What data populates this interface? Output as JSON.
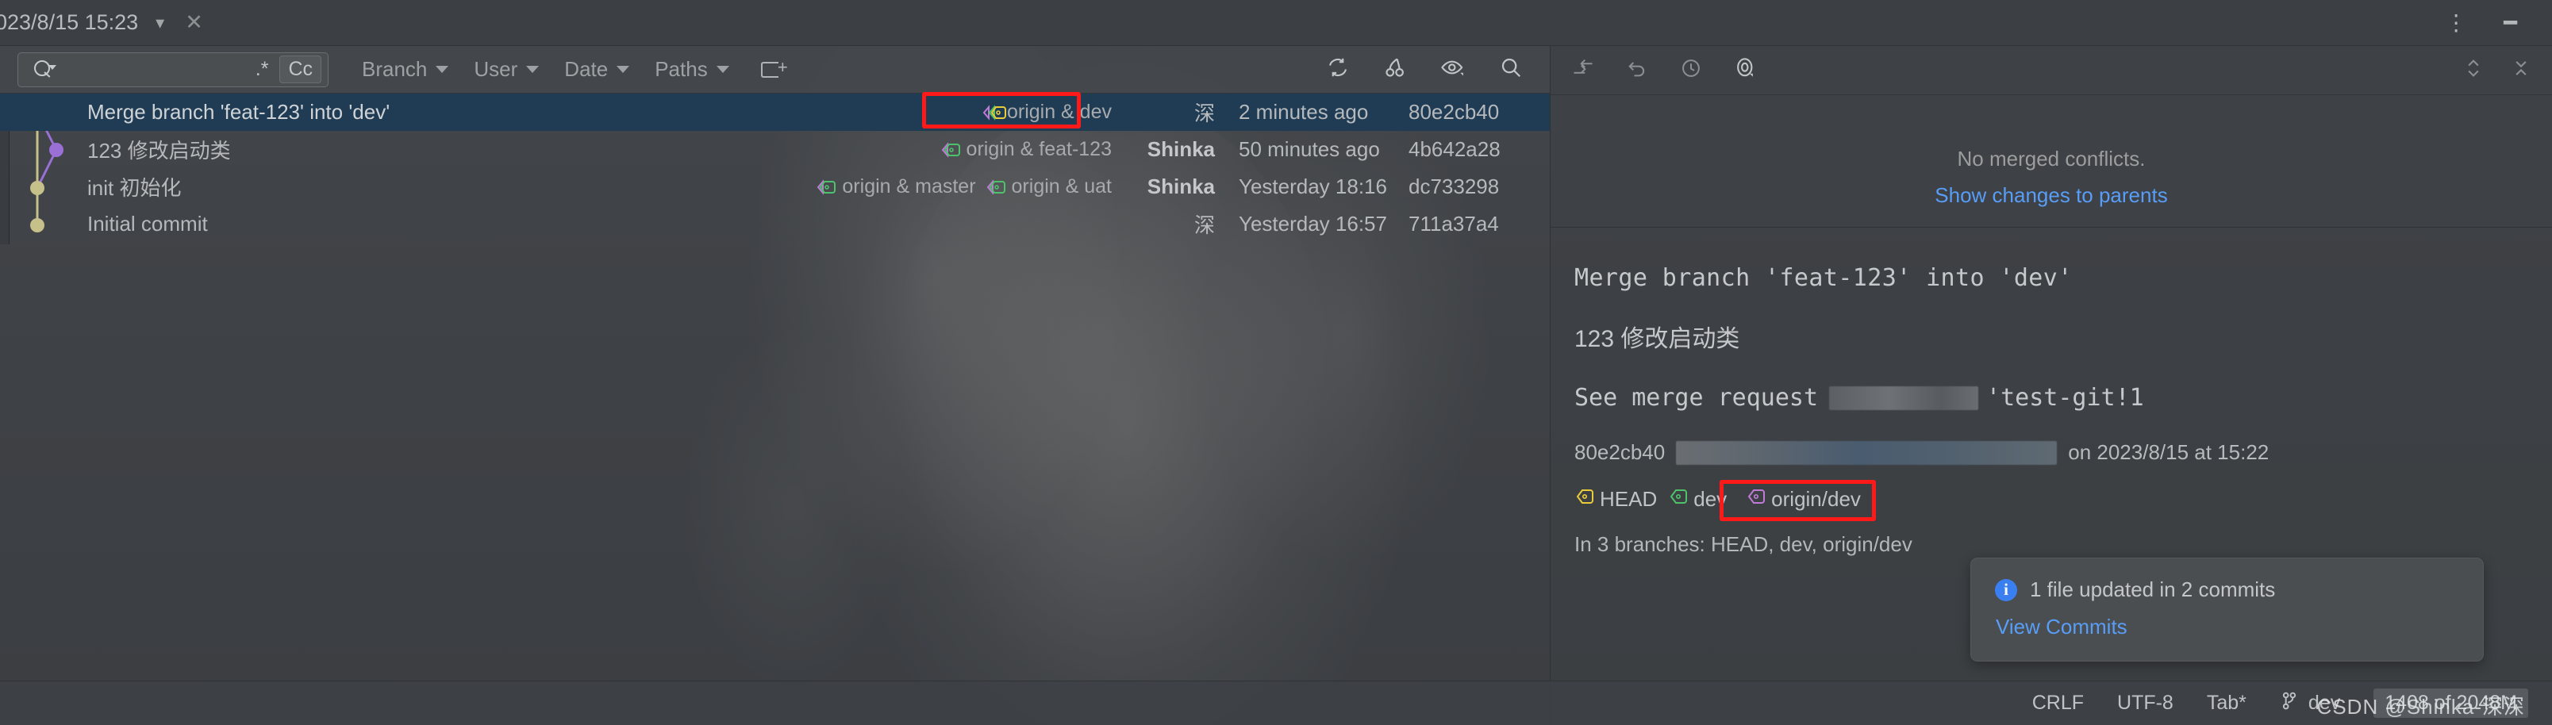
{
  "titlebar": {
    "tab_label": "023/8/15 15:23",
    "chevron_icon": "chevron-down-icon",
    "close_icon": "close-icon",
    "more_icon": "more-vertical-icon",
    "minimize_icon": "minimize-icon"
  },
  "filter_bar": {
    "search_placeholder": "",
    "search_value": "",
    "search_icon": "search-icon",
    "regex_label": ".*",
    "case_label": "Cc",
    "filters": [
      {
        "label": "Branch",
        "icon": "chevron-down-icon"
      },
      {
        "label": "User",
        "icon": "chevron-down-icon"
      },
      {
        "label": "Date",
        "icon": "chevron-down-icon"
      },
      {
        "label": "Paths",
        "icon": "chevron-down-icon"
      }
    ],
    "new_filter_icon": "new-filter-icon",
    "toolbar_icons": [
      "refresh-icon",
      "cherry-pick-icon",
      "eye-icon",
      "search-icon"
    ]
  },
  "commits": [
    {
      "subject": "Merge branch 'feat-123' into 'dev'",
      "refs": [
        {
          "label": "origin & dev",
          "type": "remote-local"
        }
      ],
      "author": "深",
      "author_cjk": true,
      "date": "2 minutes ago",
      "hash": "80e2cb40",
      "selected": true
    },
    {
      "subject": "123 修改启动类",
      "refs": [
        {
          "label": "origin & feat-123",
          "type": "remote-local"
        }
      ],
      "author": "Shinka",
      "author_cjk": false,
      "date": "50 minutes ago",
      "hash": "4b642a28",
      "selected": false
    },
    {
      "subject": "init 初始化",
      "refs": [
        {
          "label": "origin & master",
          "type": "remote-local"
        },
        {
          "label": "origin & uat",
          "type": "remote-local"
        }
      ],
      "author": "Shinka",
      "author_cjk": false,
      "date": "Yesterday 18:16",
      "hash": "dc733298",
      "selected": false
    },
    {
      "subject": "Initial commit",
      "refs": [],
      "author": "深",
      "author_cjk": true,
      "date": "Yesterday 16:57",
      "hash": "711a37a4",
      "selected": false
    }
  ],
  "right_pane": {
    "toolbar_icons": [
      "go-to-change-icon",
      "undo-icon",
      "history-icon",
      "eye-icon"
    ],
    "collapse_icon": "collapse-all-icon",
    "close_icon": "close-icon",
    "conflict_message": "No merged conflicts.",
    "conflict_link": "Show changes to parents",
    "commit_title": "Merge branch 'feat-123' into 'dev'",
    "commit_subject": "123 修改启动类",
    "merge_request_prefix": "See merge request",
    "merge_request_suffix": "'test-git!1",
    "commit_hash": "80e2cb40",
    "commit_date": "on 2023/8/15 at 15:22",
    "refs": [
      {
        "label": "HEAD",
        "color": "#e8cc3a"
      },
      {
        "label": "dev",
        "color": "#4dc26b"
      },
      {
        "label": "origin/dev",
        "color": "#c07ad8"
      }
    ],
    "branches_line": "In 3 branches: HEAD, dev, origin/dev"
  },
  "notification": {
    "icon": "info-icon",
    "message": "1 file updated in 2 commits",
    "link": "View Commits"
  },
  "statusbar": {
    "line_sep": "CRLF",
    "encoding": "UTF-8",
    "indent": "Tab*",
    "branch_icon": "git-branch-icon",
    "branch": "dev",
    "memory": "1408 of 2048M"
  },
  "watermark": "CSDN @Shinka-深深",
  "colors": {
    "selection": "#1f3c54",
    "highlight": "#ff1a1a",
    "link": "#589df6",
    "tag_yellow": "#e8cc3a",
    "tag_green": "#4dc26b",
    "tag_purple": "#c07ad8",
    "info_blue": "#3a7ff0"
  }
}
